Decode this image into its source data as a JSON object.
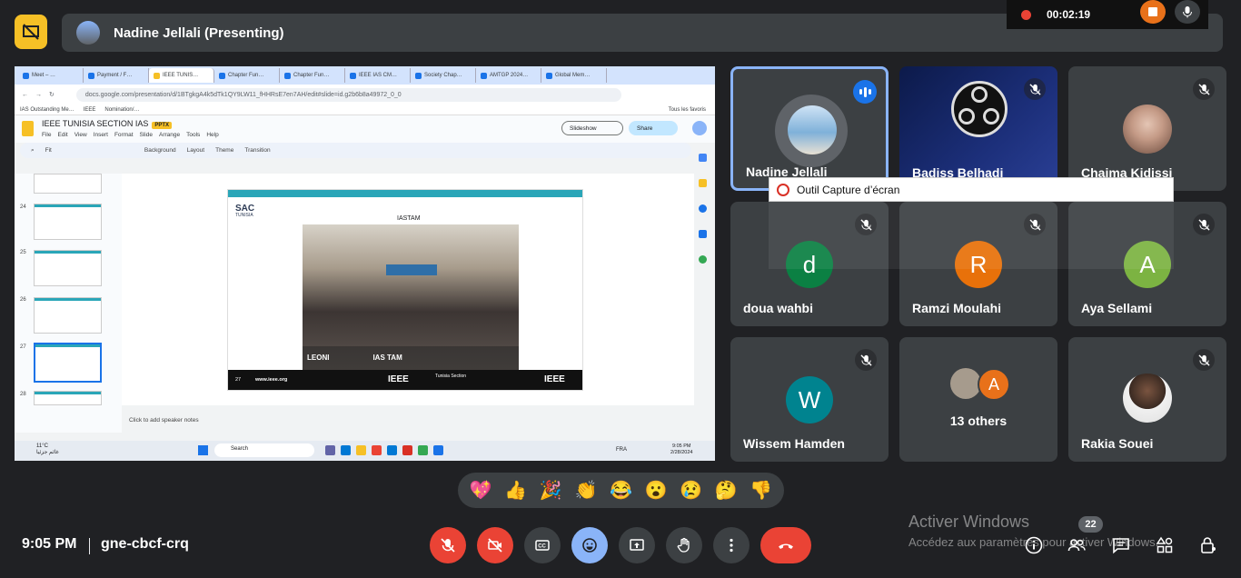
{
  "recording": {
    "time": "00:02:19"
  },
  "presenter_banner": {
    "title": "Nadine Jellali (Presenting)"
  },
  "shared_screen": {
    "tabs": [
      "Meet – …",
      "Payment / F…",
      "IEEE TUNIS…",
      "Chapter Fun…",
      "Chapter Fun…",
      "IEEE IAS CM…",
      "Society Chap…",
      "AMTGP 2024…",
      "Global Mem…"
    ],
    "url": "docs.google.com/presentation/d/1BTgkgA4k5dTk1QY9LW11_fHHRsE7en7AH/edit#slide=id.g2b6b8a49972_0_0",
    "bookmarks": [
      "IAS Outstanding Me…",
      "IEEE",
      "Nomination/…"
    ],
    "bookmarks_right": "Tous les favoris",
    "doc_title": "IEEE TUNISIA SECTION IAS",
    "doc_badge": "PPTX",
    "menu": [
      "File",
      "Edit",
      "View",
      "Insert",
      "Format",
      "Slide",
      "Arrange",
      "Tools",
      "Help"
    ],
    "slideshow_label": "Slideshow",
    "share_label": "Share",
    "toolbar": [
      "Fit",
      "Background",
      "Layout",
      "Theme",
      "Transition"
    ],
    "slide_numbers": [
      "24",
      "25",
      "26",
      "27",
      "28"
    ],
    "slide": {
      "logo_text": "SAC",
      "logo_sub": "TUNISIA",
      "heading": "IASTAM",
      "logo_leoni": "LEONI",
      "logo_iastam": "IAS TAM",
      "footer_num": "27",
      "footer_web": "www.ieee.org",
      "footer_ieee": "IEEE",
      "footer_section": "Tunisia Section"
    },
    "speaker_notes": "Click to add speaker notes",
    "taskbar": {
      "weather_temp": "11°C",
      "weather_desc": "غائم جزئيا",
      "search": "Search",
      "lang": "FRA",
      "time": "9:05 PM",
      "date": "2/28/2024"
    }
  },
  "participants": [
    {
      "name": "Nadine Jellali",
      "speaking": true
    },
    {
      "name": "Badiss Belhadj",
      "muted": true
    },
    {
      "name": "Chaima Kidissi",
      "muted": true
    },
    {
      "name": "doua wahbi",
      "initial": "d",
      "color": "#0b8043",
      "muted": true
    },
    {
      "name": "Ramzi Moulahi",
      "initial": "R",
      "color": "#e8710a",
      "muted": true
    },
    {
      "name": "Aya Sellami",
      "initial": "A",
      "color": "#7cb342",
      "muted": true
    },
    {
      "name": "Wissem Hamden",
      "initial": "W",
      "color": "#00838f",
      "muted": true
    },
    {
      "name": "13 others",
      "initial": "A",
      "color": "#e8710a"
    },
    {
      "name": "Rakia Souei",
      "muted": true
    }
  ],
  "tooltip": {
    "label": "Outil Capture d’écran"
  },
  "reactions": [
    "💖",
    "👍",
    "🎉",
    "👏",
    "😂",
    "😮",
    "😢",
    "🤔",
    "👎"
  ],
  "meeting": {
    "time": "9:05 PM",
    "code": "gne-cbcf-crq"
  },
  "people_count": "22",
  "watermark": {
    "title": "Activer Windows",
    "subtitle": "Accédez aux paramètres pour activer Windows."
  }
}
